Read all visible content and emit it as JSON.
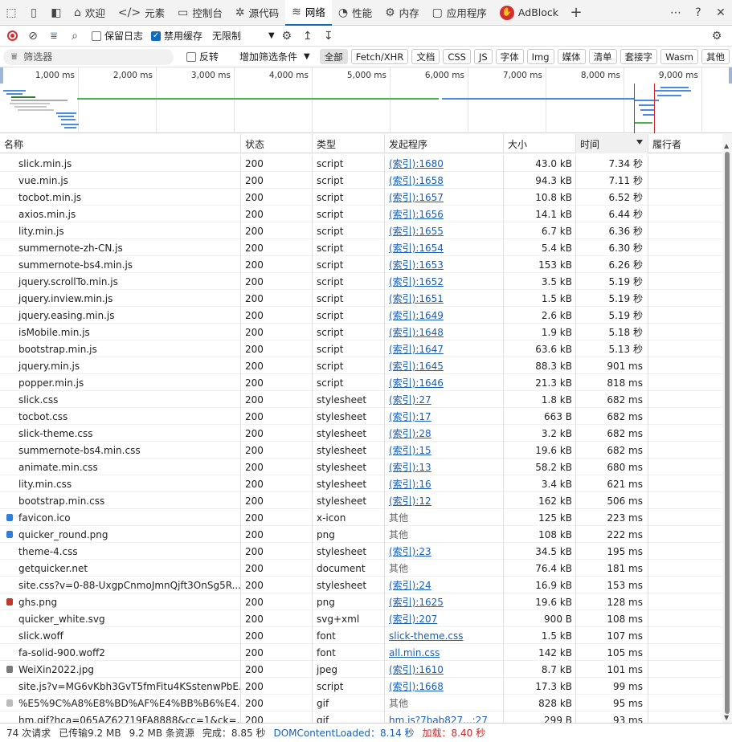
{
  "tabs": [
    {
      "label": "欢迎",
      "icon": "home-icon"
    },
    {
      "label": "元素",
      "icon": "code-icon"
    },
    {
      "label": "控制台",
      "icon": "console-icon"
    },
    {
      "label": "源代码",
      "icon": "bug-icon"
    },
    {
      "label": "网络",
      "icon": "wifi-icon",
      "active": true
    },
    {
      "label": "性能",
      "icon": "gauge-icon"
    },
    {
      "label": "内存",
      "icon": "chip-icon"
    },
    {
      "label": "应用程序",
      "icon": "window-icon"
    },
    {
      "label": "AdBlock",
      "icon": "adblock-icon"
    }
  ],
  "toolbar": {
    "preserve_log": "保留日志",
    "disable_cache": "禁用缓存",
    "throttle": "无限制"
  },
  "filterbar": {
    "placeholder": "筛选器",
    "invert": "反转",
    "more_filters": "增加筛选条件",
    "types": [
      "全部",
      "Fetch/XHR",
      "文档",
      "CSS",
      "JS",
      "字体",
      "Img",
      "媒体",
      "清单",
      "套接字",
      "Wasm",
      "其他"
    ]
  },
  "overview": {
    "ticks": [
      "1,000 ms",
      "2,000 ms",
      "3,000 ms",
      "4,000 ms",
      "5,000 ms",
      "6,000 ms",
      "7,000 ms",
      "8,000 ms",
      "9,000 ms"
    ]
  },
  "columns": [
    "名称",
    "状态",
    "类型",
    "发起程序",
    "大小",
    "时间",
    "履行者"
  ],
  "rows": [
    {
      "name": "slick.min.js",
      "status": "200",
      "type": "script",
      "initiator": "(索引):1680",
      "size": "43.0 kB",
      "time": "7.34 秒"
    },
    {
      "name": "vue.min.js",
      "status": "200",
      "type": "script",
      "initiator": "(索引):1658",
      "size": "94.3 kB",
      "time": "7.11 秒"
    },
    {
      "name": "tocbot.min.js",
      "status": "200",
      "type": "script",
      "initiator": "(索引):1657",
      "size": "10.8 kB",
      "time": "6.52 秒"
    },
    {
      "name": "axios.min.js",
      "status": "200",
      "type": "script",
      "initiator": "(索引):1656",
      "size": "14.1 kB",
      "time": "6.44 秒"
    },
    {
      "name": "lity.min.js",
      "status": "200",
      "type": "script",
      "initiator": "(索引):1655",
      "size": "6.7 kB",
      "time": "6.36 秒"
    },
    {
      "name": "summernote-zh-CN.js",
      "status": "200",
      "type": "script",
      "initiator": "(索引):1654",
      "size": "5.4 kB",
      "time": "6.30 秒"
    },
    {
      "name": "summernote-bs4.min.js",
      "status": "200",
      "type": "script",
      "initiator": "(索引):1653",
      "size": "153 kB",
      "time": "6.26 秒"
    },
    {
      "name": "jquery.scrollTo.min.js",
      "status": "200",
      "type": "script",
      "initiator": "(索引):1652",
      "size": "3.5 kB",
      "time": "5.19 秒"
    },
    {
      "name": "jquery.inview.min.js",
      "status": "200",
      "type": "script",
      "initiator": "(索引):1651",
      "size": "1.5 kB",
      "time": "5.19 秒"
    },
    {
      "name": "jquery.easing.min.js",
      "status": "200",
      "type": "script",
      "initiator": "(索引):1649",
      "size": "2.6 kB",
      "time": "5.19 秒"
    },
    {
      "name": "isMobile.min.js",
      "status": "200",
      "type": "script",
      "initiator": "(索引):1648",
      "size": "1.9 kB",
      "time": "5.18 秒"
    },
    {
      "name": "bootstrap.min.js",
      "status": "200",
      "type": "script",
      "initiator": "(索引):1647",
      "size": "63.6 kB",
      "time": "5.13 秒"
    },
    {
      "name": "jquery.min.js",
      "status": "200",
      "type": "script",
      "initiator": "(索引):1645",
      "size": "88.3 kB",
      "time": "901 ms"
    },
    {
      "name": "popper.min.js",
      "status": "200",
      "type": "script",
      "initiator": "(索引):1646",
      "size": "21.3 kB",
      "time": "818 ms"
    },
    {
      "name": "slick.css",
      "status": "200",
      "type": "stylesheet",
      "initiator": "(索引):27",
      "size": "1.8 kB",
      "time": "682 ms"
    },
    {
      "name": "tocbot.css",
      "status": "200",
      "type": "stylesheet",
      "initiator": "(索引):17",
      "size": "663 B",
      "time": "682 ms"
    },
    {
      "name": "slick-theme.css",
      "status": "200",
      "type": "stylesheet",
      "initiator": "(索引):28",
      "size": "3.2 kB",
      "time": "682 ms"
    },
    {
      "name": "summernote-bs4.min.css",
      "status": "200",
      "type": "stylesheet",
      "initiator": "(索引):15",
      "size": "19.6 kB",
      "time": "682 ms"
    },
    {
      "name": "animate.min.css",
      "status": "200",
      "type": "stylesheet",
      "initiator": "(索引):13",
      "size": "58.2 kB",
      "time": "680 ms"
    },
    {
      "name": "lity.min.css",
      "status": "200",
      "type": "stylesheet",
      "initiator": "(索引):16",
      "size": "3.4 kB",
      "time": "621 ms"
    },
    {
      "name": "bootstrap.min.css",
      "status": "200",
      "type": "stylesheet",
      "initiator": "(索引):12",
      "size": "162 kB",
      "time": "506 ms"
    },
    {
      "name": "favicon.ico",
      "status": "200",
      "type": "x-icon",
      "initiator": "其他",
      "size": "125 kB",
      "time": "223 ms",
      "icon": "#2f7fd8"
    },
    {
      "name": "quicker_round.png",
      "status": "200",
      "type": "png",
      "initiator": "其他",
      "size": "108 kB",
      "time": "222 ms",
      "icon": "#2f7fd8"
    },
    {
      "name": "theme-4.css",
      "status": "200",
      "type": "stylesheet",
      "initiator": "(索引):23",
      "size": "34.5 kB",
      "time": "195 ms"
    },
    {
      "name": "getquicker.net",
      "status": "200",
      "type": "document",
      "initiator": "其他",
      "size": "76.4 kB",
      "time": "181 ms"
    },
    {
      "name": "site.css?v=0-88-UxgpCnmoJmnQjft3OnSg5R...",
      "status": "200",
      "type": "stylesheet",
      "initiator": "(索引):24",
      "size": "16.9 kB",
      "time": "153 ms"
    },
    {
      "name": "ghs.png",
      "status": "200",
      "type": "png",
      "initiator": "(索引):1625",
      "size": "19.6 kB",
      "time": "128 ms",
      "icon": "#c0392b"
    },
    {
      "name": "quicker_white.svg",
      "status": "200",
      "type": "svg+xml",
      "initiator": "(索引):207",
      "size": "900 B",
      "time": "108 ms"
    },
    {
      "name": "slick.woff",
      "status": "200",
      "type": "font",
      "initiator": "slick-theme.css",
      "size": "1.5 kB",
      "time": "107 ms"
    },
    {
      "name": "fa-solid-900.woff2",
      "status": "200",
      "type": "font",
      "initiator": "all.min.css",
      "size": "142 kB",
      "time": "105 ms"
    },
    {
      "name": "WeiXin2022.jpg",
      "status": "200",
      "type": "jpeg",
      "initiator": "(索引):1610",
      "size": "8.7 kB",
      "time": "101 ms",
      "icon": "#7a7a7a"
    },
    {
      "name": "site.js?v=MG6vKbh3GvT5fmFitu4KSstenwPbE...",
      "status": "200",
      "type": "script",
      "initiator": "(索引):1668",
      "size": "17.3 kB",
      "time": "99 ms"
    },
    {
      "name": "%E5%9C%A8%E8%BD%AF%E4%BB%B6%E4...",
      "status": "200",
      "type": "gif",
      "initiator": "其他",
      "size": "828 kB",
      "time": "95 ms",
      "icon": "#bbbbbb"
    },
    {
      "name": "hm.gif?hca=065AZ62719FA8888&cc=1&ck=...",
      "status": "200",
      "type": "gif",
      "initiator": "hm.js?7bab827...:27",
      "size": "299 B",
      "time": "93 ms"
    }
  ],
  "status": {
    "requests": "74 次请求",
    "transferred": "已传输9.2 MB",
    "resources": "9.2 MB 条资源",
    "finish": "完成：8.85 秒",
    "dcl": "DOMContentLoaded：8.14 秒",
    "load": "加载：8.40 秒",
    "dcl_color": "#1a5fb4",
    "load_color": "#c62828"
  }
}
